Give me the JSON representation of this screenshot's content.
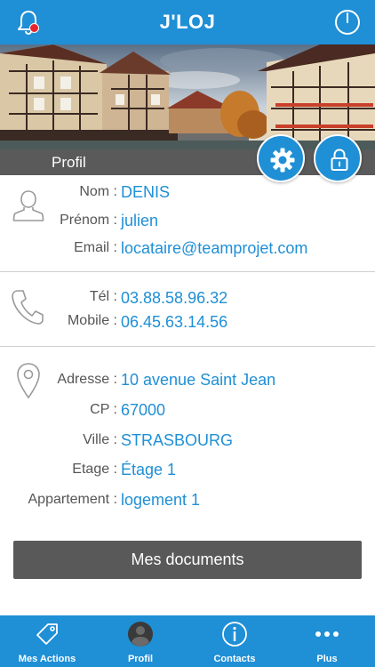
{
  "app": {
    "title": "J'LOJ"
  },
  "section": {
    "title": "Profil"
  },
  "identity": {
    "nom_label": "Nom :",
    "nom": "DENIS",
    "prenom_label": "Prénom :",
    "prenom": "julien",
    "email_label": "Email :",
    "email": "locataire@teamprojet.com"
  },
  "phones": {
    "tel_label": "Tél :",
    "tel": "03.88.58.96.32",
    "mobile_label": "Mobile :",
    "mobile": "06.45.63.14.56"
  },
  "address": {
    "adresse_label": "Adresse :",
    "adresse": "10 avenue Saint Jean",
    "cp_label": "CP :",
    "cp": "67000",
    "ville_label": "Ville :",
    "ville": "STRASBOURG",
    "etage_label": "Etage :",
    "etage": "Étage 1",
    "appartement_label": "Appartement :",
    "appartement": "logement 1"
  },
  "documents_button": "Mes documents",
  "tabs": [
    {
      "label": "Mes Actions",
      "icon": "tag-icon"
    },
    {
      "label": "Profil",
      "icon": "user-avatar-icon"
    },
    {
      "label": "Contacts",
      "icon": "info-icon"
    },
    {
      "label": "Plus",
      "icon": "more-dots-icon"
    }
  ],
  "colors": {
    "primary": "#1f8fd6",
    "dark_bar": "#5a5a5a",
    "notification": "#e8252a"
  }
}
